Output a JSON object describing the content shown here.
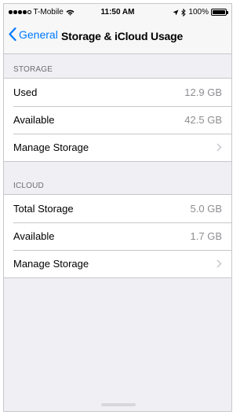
{
  "status_bar": {
    "carrier": "T-Mobile",
    "time": "11:50 AM",
    "battery": "100%",
    "battery_level": 1.0
  },
  "nav": {
    "back_label": "General",
    "title": "Storage & iCloud Usage"
  },
  "storage": {
    "header": "STORAGE",
    "rows": [
      {
        "label": "Used",
        "value": "12.9 GB"
      },
      {
        "label": "Available",
        "value": "42.5 GB"
      },
      {
        "label": "Manage Storage"
      }
    ]
  },
  "icloud": {
    "header": "ICLOUD",
    "rows": [
      {
        "label": "Total Storage",
        "value": "5.0 GB"
      },
      {
        "label": "Available",
        "value": "1.7 GB"
      },
      {
        "label": "Manage Storage"
      }
    ]
  },
  "icons": {
    "back": "chevron-left-icon",
    "disclosure": "chevron-right-icon",
    "wifi": "wifi-icon",
    "bluetooth": "bluetooth-icon",
    "location": "location-arrow-icon",
    "battery": "battery-icon"
  },
  "colors": {
    "accent": "#007aff",
    "background": "#efeff4",
    "secondary_text": "#8e8e93"
  }
}
